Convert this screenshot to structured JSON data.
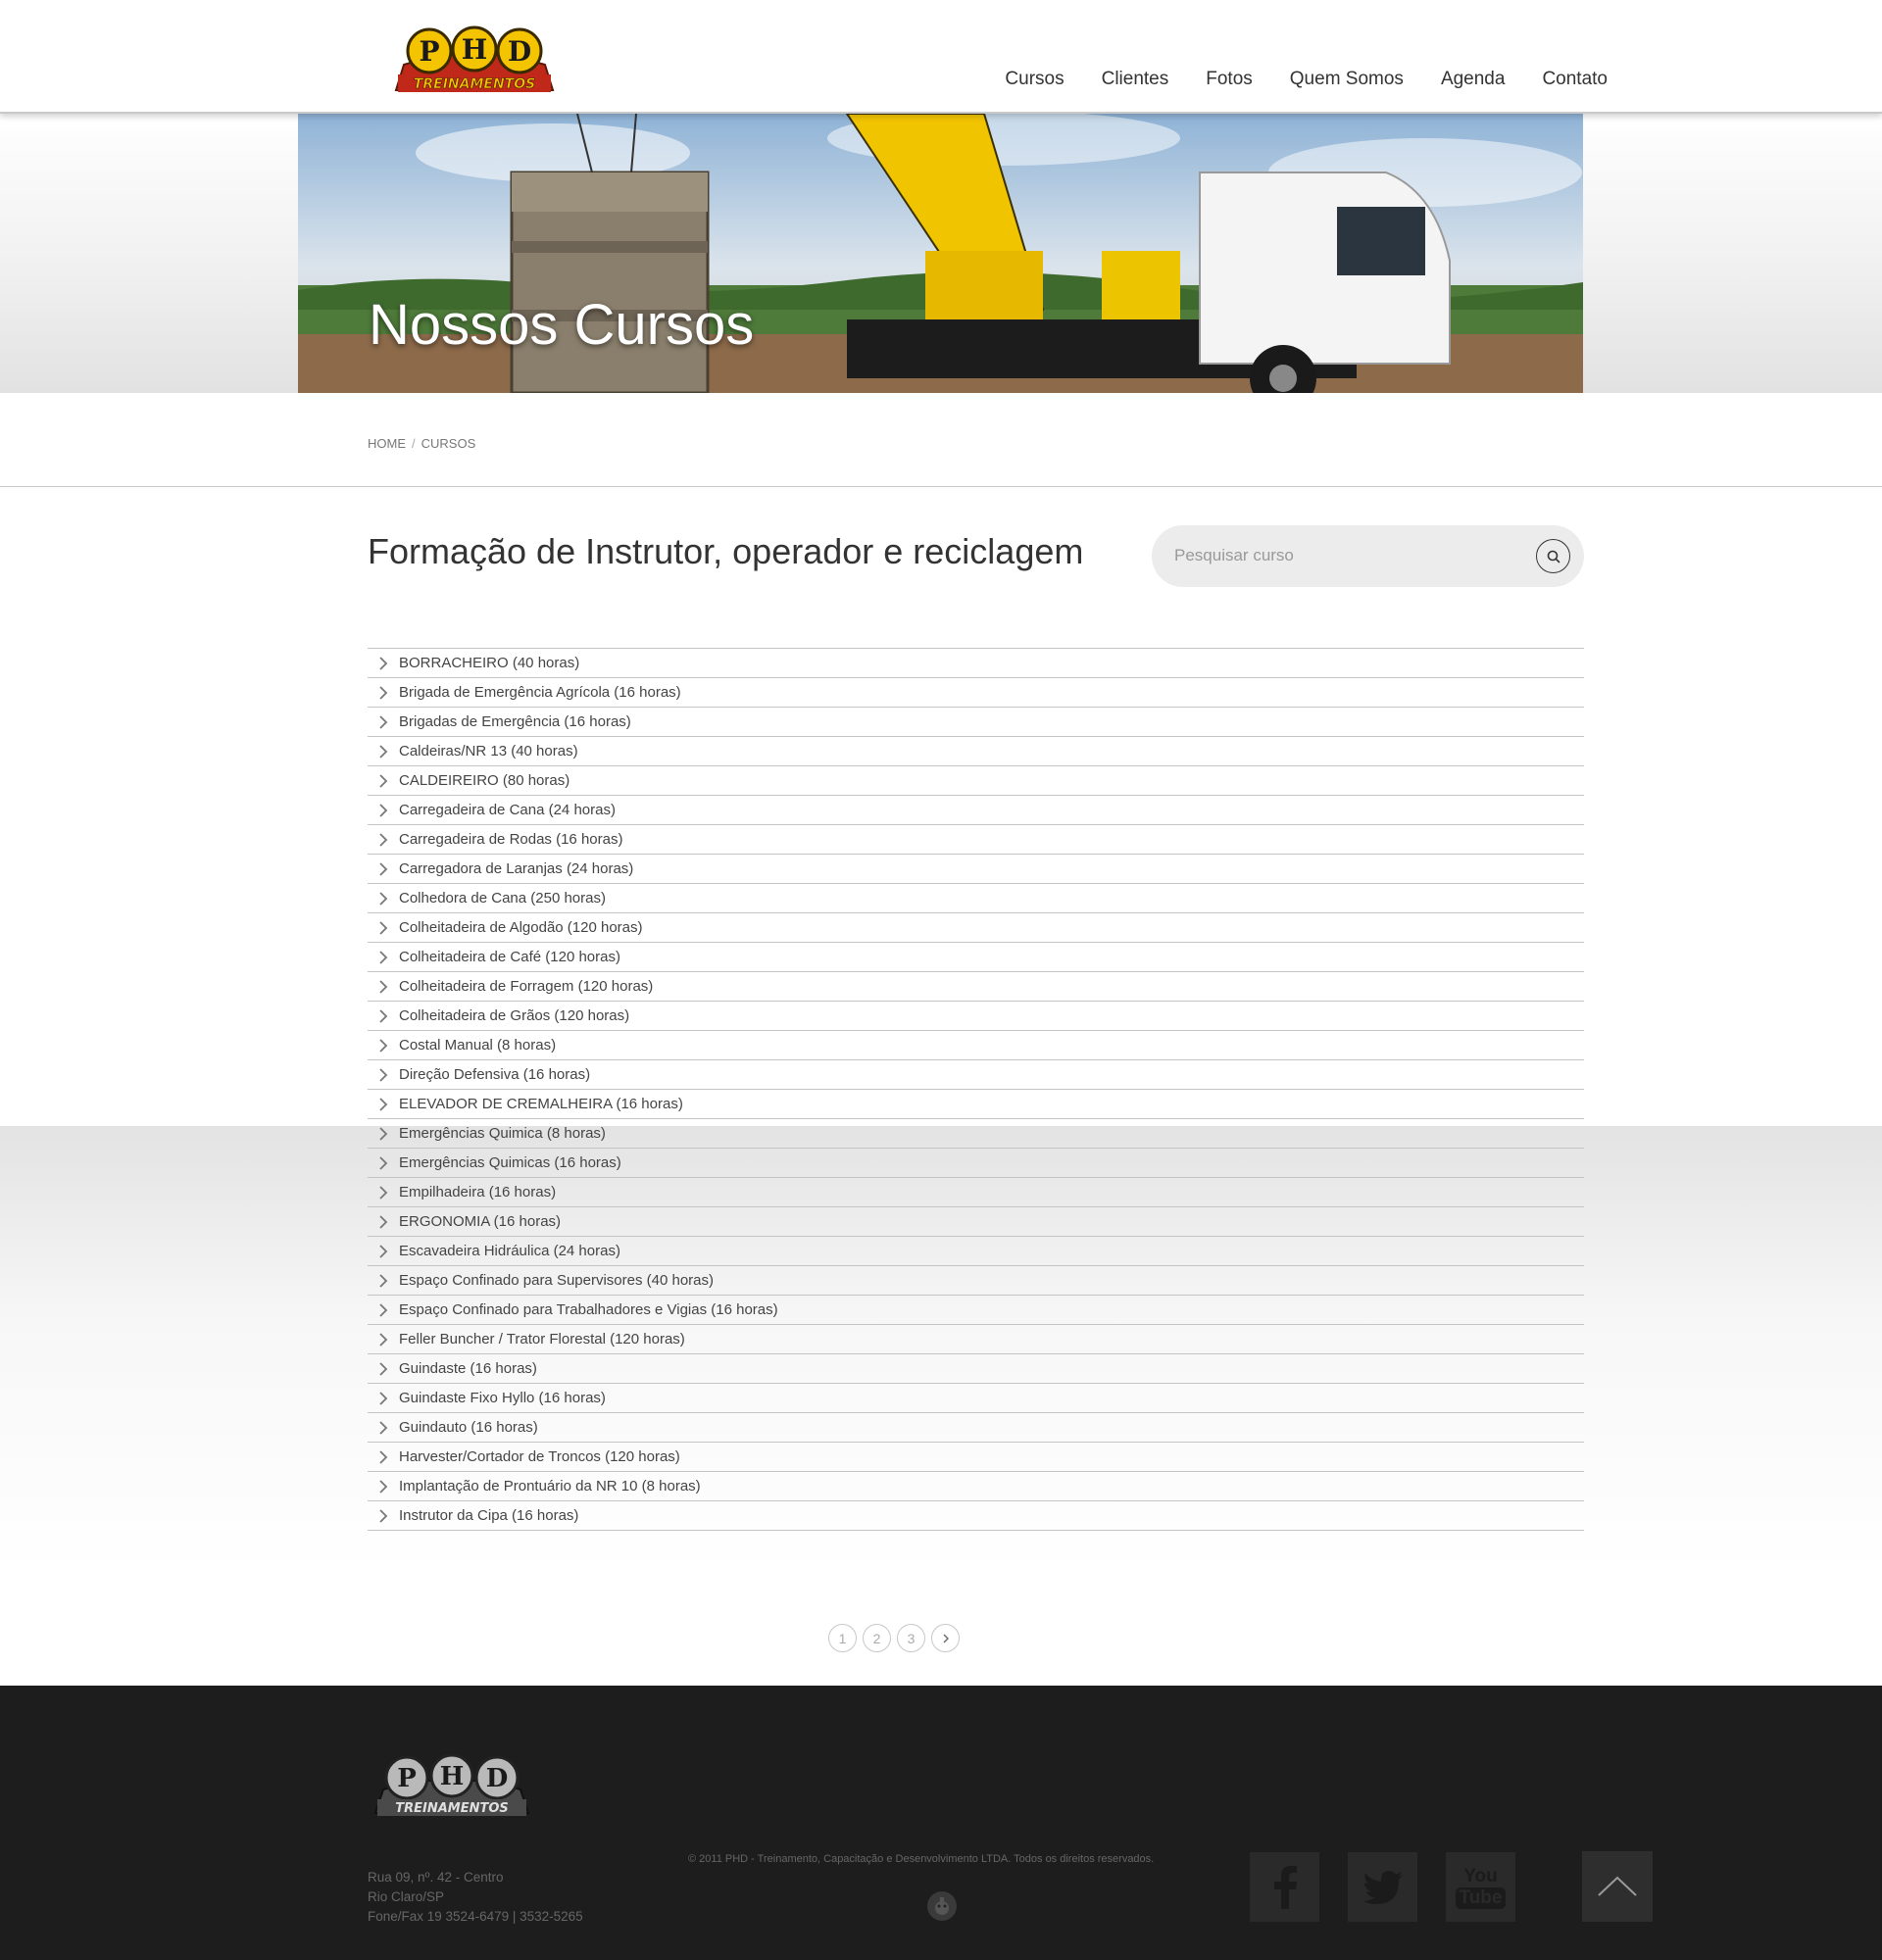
{
  "brand": {
    "logo_line1": "PHD",
    "logo_line2": "TREINAMENTOS"
  },
  "nav": [
    "Cursos",
    "Clientes",
    "Fotos",
    "Quem Somos",
    "Agenda",
    "Contato"
  ],
  "hero": {
    "title": "Nossos Cursos"
  },
  "breadcrumb": {
    "home": "HOME",
    "separator": "/",
    "current": "CURSOS"
  },
  "main": {
    "title": "Formação de Instrutor, operador e reciclagem",
    "search_placeholder": "Pesquisar curso",
    "search_icon": "search-icon"
  },
  "courses": [
    "BORRACHEIRO (40 horas)",
    "Brigada de Emergência Agrícola (16 horas)",
    "Brigadas de Emergência (16 horas)",
    "Caldeiras/NR 13 (40 horas)",
    "CALDEIREIRO (80 horas)",
    "Carregadeira de Cana (24 horas)",
    "Carregadeira de Rodas (16 horas)",
    "Carregadora de Laranjas (24 horas)",
    "Colhedora de Cana (250 horas)",
    "Colheitadeira de Algodão (120 horas)",
    "Colheitadeira de Café (120 horas)",
    "Colheitadeira de Forragem (120 horas)",
    "Colheitadeira de Grãos (120 horas)",
    "Costal Manual (8 horas)",
    "Direção Defensiva (16 horas)",
    "ELEVADOR DE CREMALHEIRA (16 horas)",
    "Emergências Quimica (8 horas)",
    "Emergências Quimicas (16 horas)",
    "Empilhadeira (16 horas)",
    "ERGONOMIA (16 horas)",
    "Escavadeira Hidráulica (24 horas)",
    "Espaço Confinado para Supervisores (40 horas)",
    "Espaço Confinado para Trabalhadores e Vigias (16 horas)",
    "Feller Buncher / Trator Florestal (120 horas)",
    "Guindaste (16 horas)",
    "Guindaste Fixo Hyllo (16 horas)",
    "Guindauto (16 horas)",
    "Harvester/Cortador de Troncos (120 horas)",
    "Implantação de Prontuário da NR 10 (8 horas)",
    "Instrutor da Cipa (16 horas)"
  ],
  "pagination": {
    "pages": [
      "1",
      "2",
      "3"
    ],
    "next_icon": "chevron-right-icon"
  },
  "footer": {
    "address_line1": "Rua 09, nº. 42 - Centro",
    "address_line2": "Rio Claro/SP",
    "address_line3": "Fone/Fax 19 3524-6479 | 3532-5265",
    "copyright": "© 2011 PHD - Treinamento, Capacitação e Desenvolvimento LTDA. Todos os direitos reservados.",
    "youtube_line1": "You",
    "youtube_line2": "Tube"
  },
  "colors": {
    "logo_yellow": "#f5c400",
    "logo_red": "#c0281a",
    "footer_bg": "#1d1d1d",
    "social_bg": "#2a2a2a"
  }
}
